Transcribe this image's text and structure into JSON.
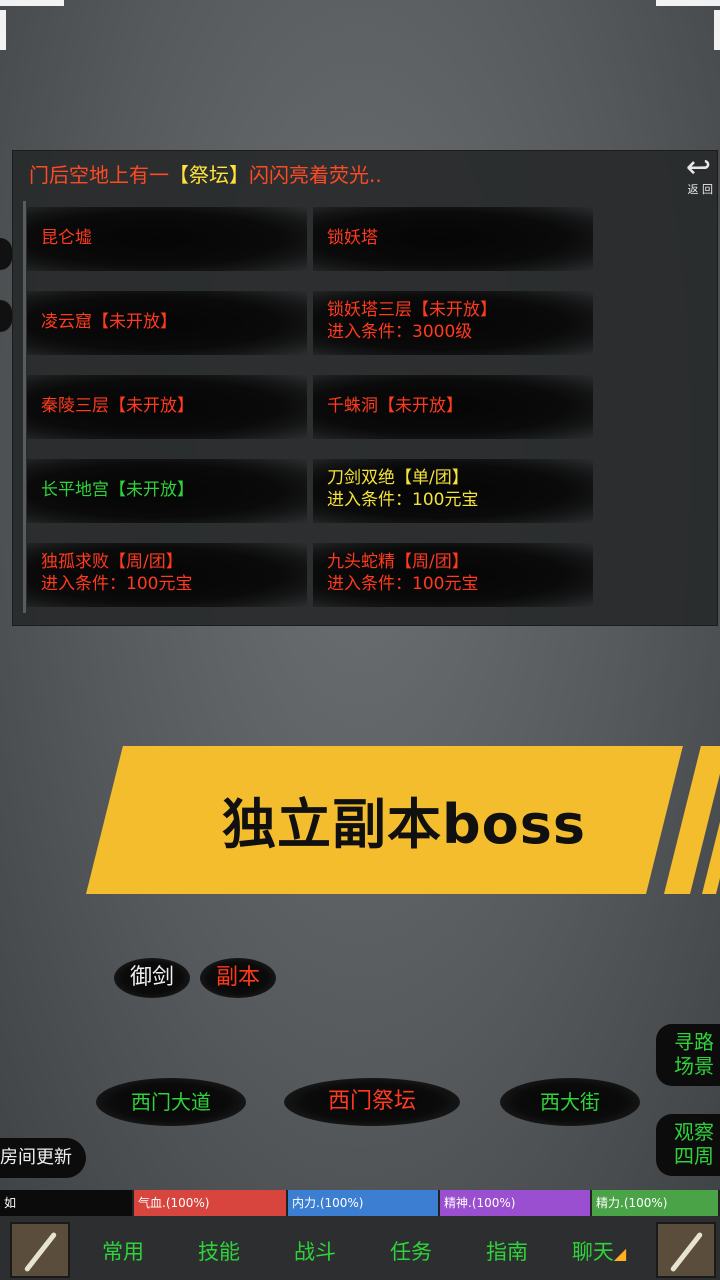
{
  "panel": {
    "title_prefix": "门后空地上有一",
    "title_highlight": "【祭坛】",
    "title_suffix": "闪闪亮着荧光..",
    "back_label": "返 回",
    "dungeons": [
      {
        "name": "昆仑墟",
        "requirement": "",
        "color": "red"
      },
      {
        "name": "锁妖塔",
        "requirement": "",
        "color": "red"
      },
      {
        "name": "凌云窟【未开放】",
        "requirement": "",
        "color": "red"
      },
      {
        "name": "锁妖塔三层【未开放】",
        "requirement": "进入条件：3000级",
        "color": "red"
      },
      {
        "name": "秦陵三层【未开放】",
        "requirement": "",
        "color": "red"
      },
      {
        "name": "千蛛洞【未开放】",
        "requirement": "",
        "color": "red"
      },
      {
        "name": "长平地宫【未开放】",
        "requirement": "",
        "color": "green"
      },
      {
        "name": "刀剑双绝【单/团】",
        "requirement": "进入条件：100元宝",
        "color": "yellow"
      },
      {
        "name": "独孤求败【周/团】",
        "requirement": "进入条件：100元宝",
        "color": "red"
      },
      {
        "name": "九头蛇精【周/团】",
        "requirement": "进入条件：100元宝",
        "color": "red"
      }
    ]
  },
  "banner": {
    "text": "独立副本boss",
    "color": "#f3bd2d"
  },
  "tags": {
    "sword": "御剑",
    "dungeon": "副本"
  },
  "locations": [
    "西门大道",
    "西门祭坛",
    "西大街"
  ],
  "side_buttons": {
    "pathfind": "寻路\n场景",
    "observe": "观察\n四周"
  },
  "room_update": "房间更新",
  "status": {
    "name": "如",
    "hp": "气血.(100%)",
    "mp": "内力.(100%)",
    "spirit": "精神.(100%)",
    "energy": "精力.(100%)"
  },
  "toolbar": [
    "常用",
    "技能",
    "战斗",
    "任务",
    "指南",
    "聊天"
  ],
  "colors": {
    "red_text": "#ff3a1e",
    "green_text": "#2fd23a",
    "yellow_text": "#f3e23a",
    "hp_bar": "#d8453e",
    "mp_bar": "#3c7fd2",
    "spirit_bar": "#9a4fd0",
    "energy_bar": "#4aa447"
  }
}
